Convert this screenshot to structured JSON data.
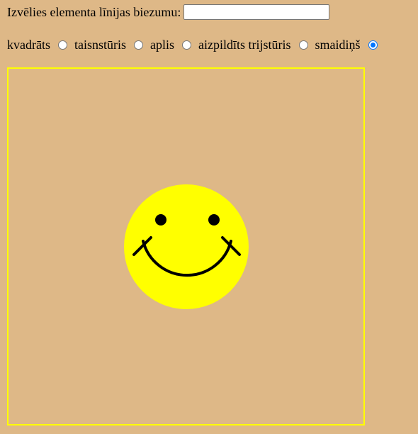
{
  "line_width": {
    "label": "Izvēlies elementa līnijas biezumu:",
    "value": "",
    "placeholder": ""
  },
  "shapes": {
    "options": [
      {
        "label": "kvadrāts",
        "checked": false
      },
      {
        "label": "taisnstūris",
        "checked": false
      },
      {
        "label": "aplis",
        "checked": false
      },
      {
        "label": "aizpildīts trijstūris",
        "checked": false
      },
      {
        "label": "smaidiņš",
        "checked": true
      }
    ]
  },
  "canvas": {
    "frame_color": "#ffff00",
    "background": "#deb887",
    "drawing": {
      "shape": "smiley",
      "face_color": "#ffff00",
      "feature_color": "#000000"
    }
  }
}
